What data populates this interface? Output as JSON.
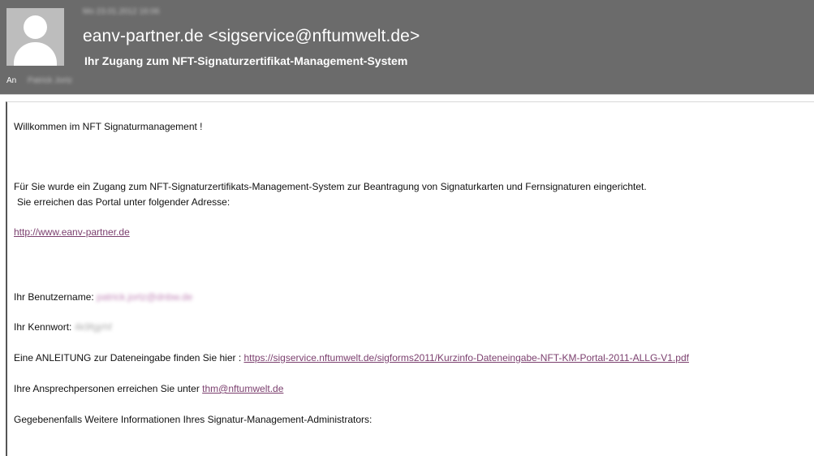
{
  "header": {
    "date": "Mo 23.01.2012 16:06",
    "from": "eanv-partner.de <sigservice@nftumwelt.de>",
    "subject": "Ihr Zugang zum NFT-Signaturzertifikat-Management-System",
    "to_label": "An",
    "to_value": "Patrick Jortz"
  },
  "message": {
    "greeting": "Willkommen im NFT Signaturmanagement !",
    "intro_1": "Für Sie wurde ein Zugang zum NFT-Signaturzertifikats-Management-System zur Beantragung von Signaturkarten und Fernsignaturen eingerichtet.",
    "intro_2": "Sie erreichen das Portal unter folgender Adresse:",
    "portal_url": "http://www.eanv-partner.de",
    "username_label": "Ihr Benutzername:",
    "username_value": "patrick.jortz@dnbw.de",
    "password_label": "Ihr Kennwort:",
    "password_value": "4k9fgjrhf",
    "guide_label": "Eine ANLEITUNG zur Dateneingabe finden Sie hier :",
    "guide_url": "https://sigservice.nftumwelt.de/sigforms2011/Kurzinfo-Dateneingabe-NFT-KM-Portal-2011-ALLG-V1.pdf",
    "contact_label": "Ihre Ansprechpersonen erreichen Sie unter",
    "contact_email": "thm@nftumwelt.de",
    "additional_info": "Gegebenenfalls Weitere Informationen Ihres Signatur-Management-Administrators:"
  }
}
